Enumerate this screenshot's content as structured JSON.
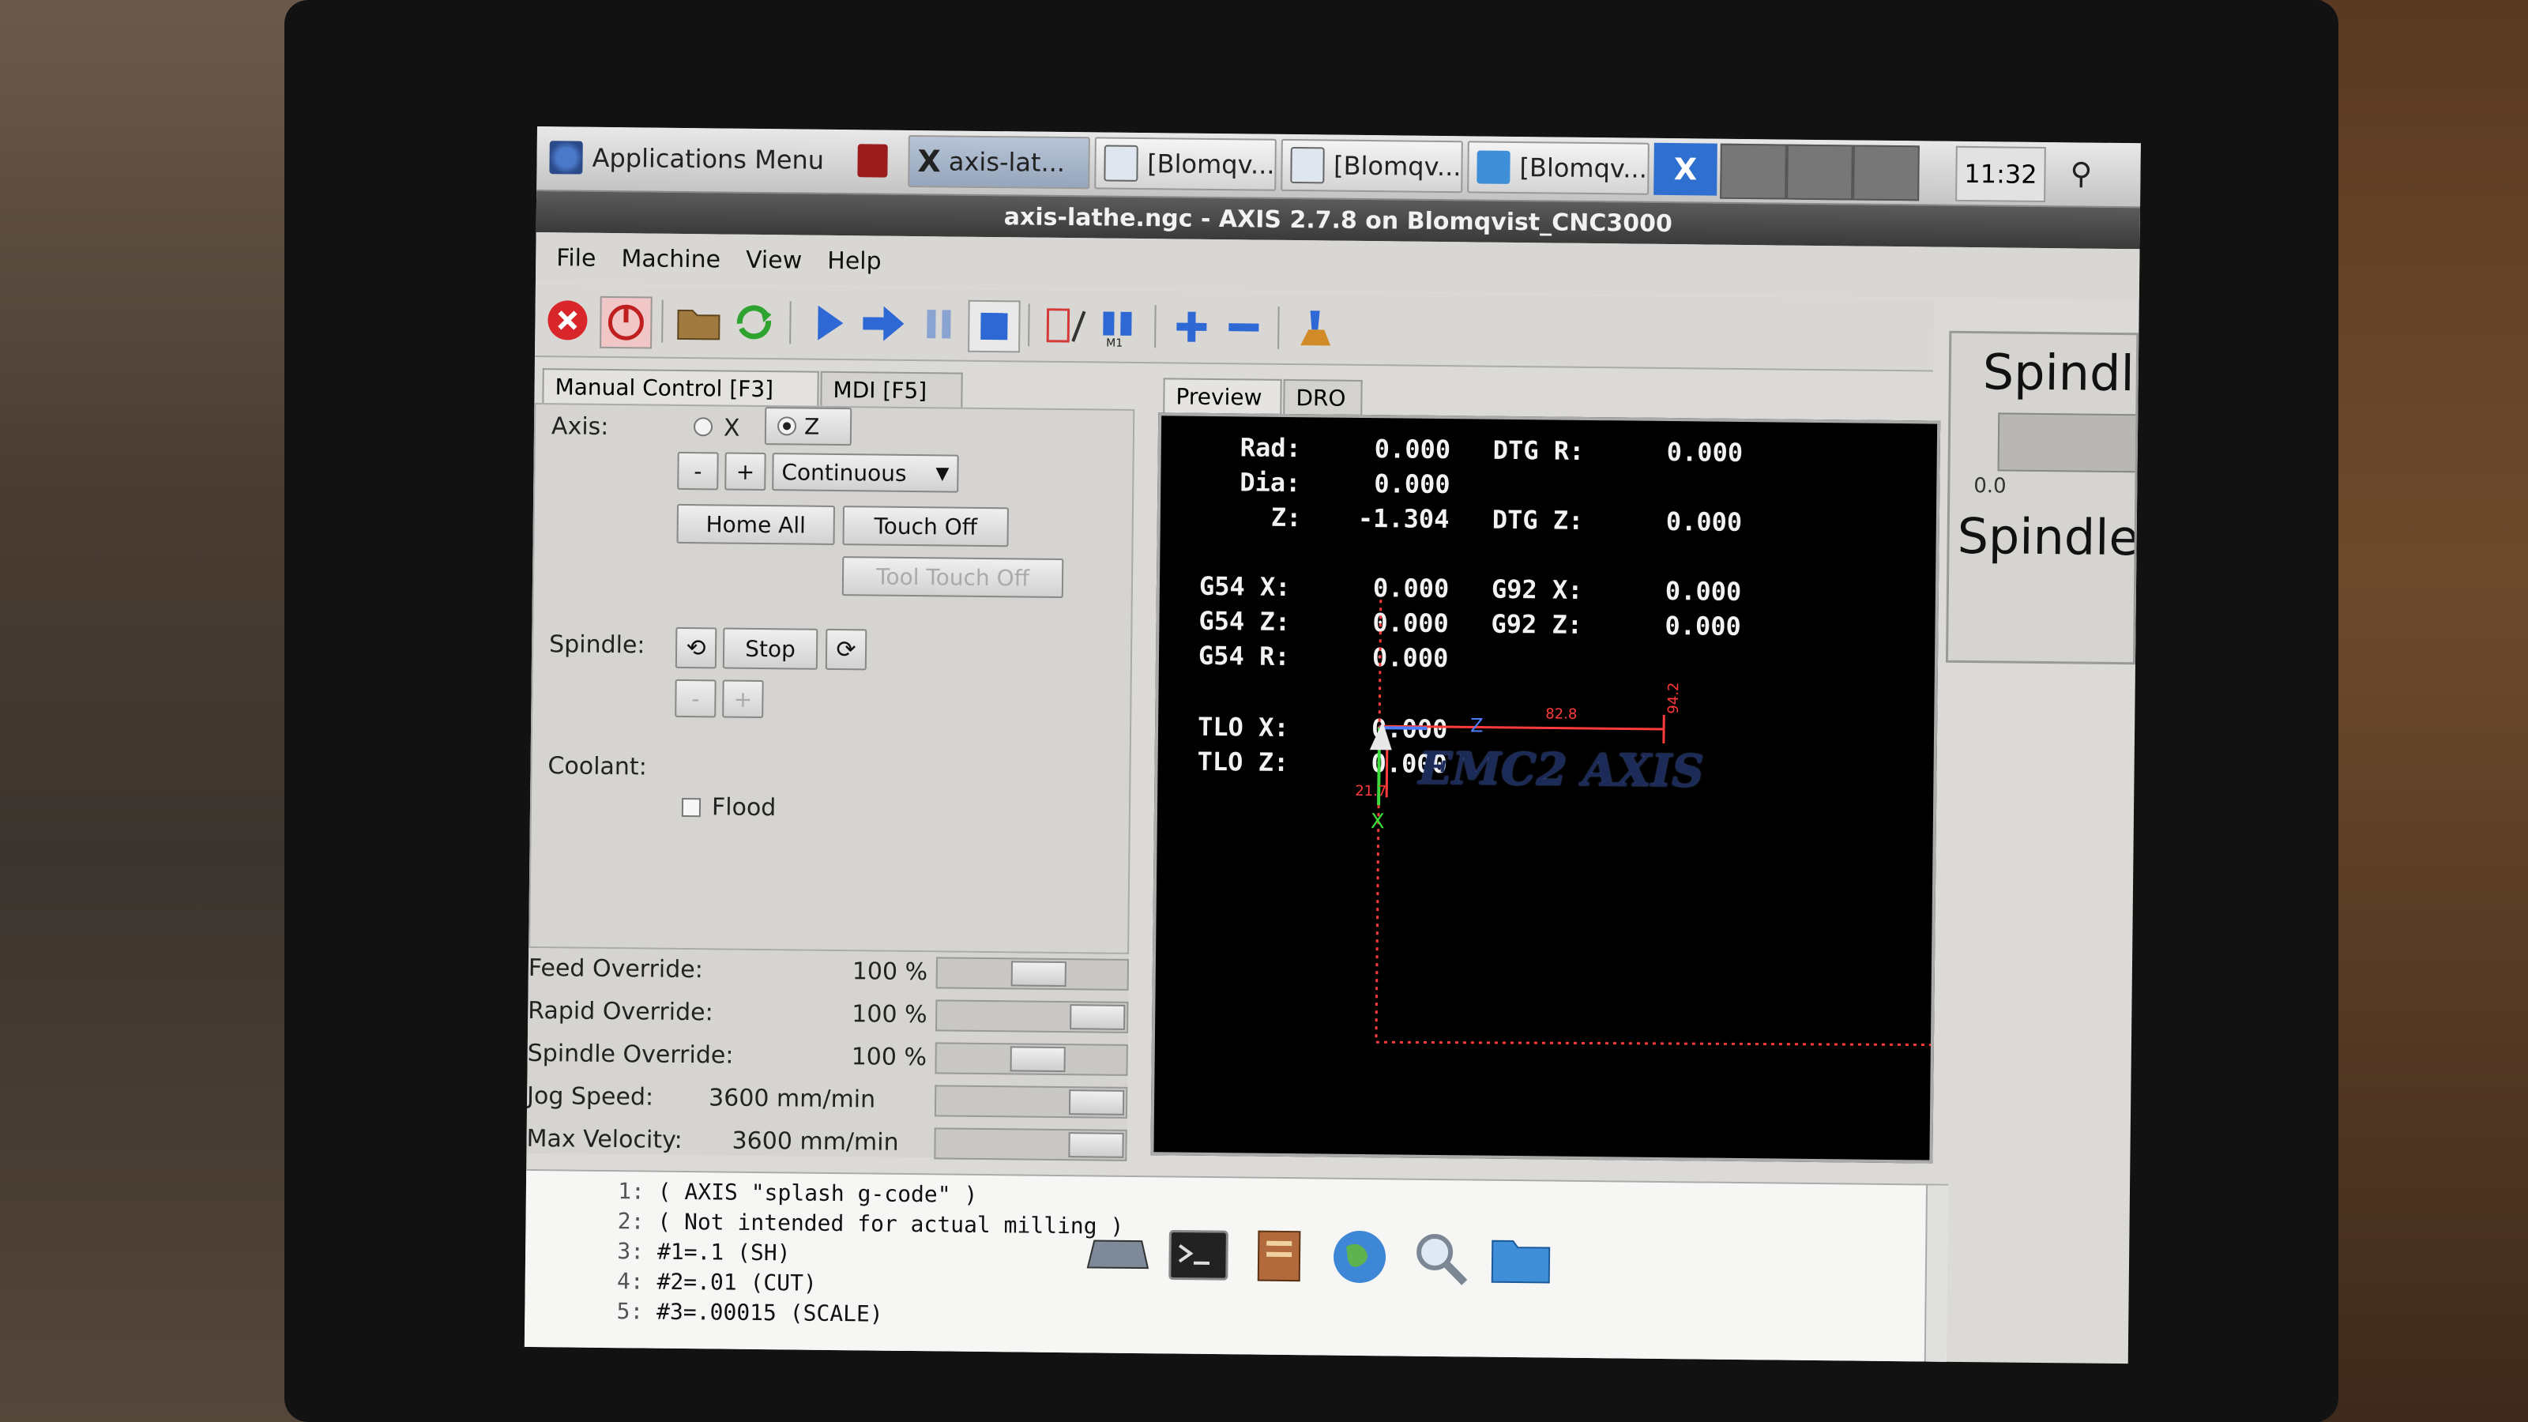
{
  "taskbar": {
    "apps_menu": "Applications Menu",
    "windows": [
      "axis-lat...",
      "[Blomqv...",
      "[Blomqv...",
      "[Blomqv..."
    ],
    "clock": "11:32"
  },
  "window_title": "axis-lathe.ngc - AXIS 2.7.8 on Blomqvist_CNC3000",
  "menu": [
    "File",
    "Machine",
    "View",
    "Help"
  ],
  "toolbar_icons": [
    "estop-icon",
    "power-icon",
    "open-icon",
    "reload-icon",
    "run-icon",
    "step-icon",
    "pause-icon",
    "stop-icon",
    "block-delete-icon",
    "optional-stop-icon",
    "zoom-in-icon",
    "zoom-out-icon",
    "clear-plot-icon"
  ],
  "left_tabs": [
    "Manual Control [F3]",
    "MDI [F5]"
  ],
  "manual": {
    "axis_label": "Axis:",
    "axis_x": "X",
    "axis_z": "Z",
    "jog_minus": "-",
    "jog_plus": "+",
    "jog_mode": "Continuous",
    "home_all": "Home All",
    "touch_off": "Touch Off",
    "tool_touch_off": "Tool Touch Off",
    "spindle_label": "Spindle:",
    "spindle_stop": "Stop",
    "spindle_minus": "-",
    "spindle_plus": "+",
    "coolant_label": "Coolant:",
    "flood": "Flood"
  },
  "overrides": [
    {
      "label": "Feed Override:",
      "value": "100 %",
      "level": 0.55
    },
    {
      "label": "Rapid Override:",
      "value": "100 %",
      "level": 1.0
    },
    {
      "label": "Spindle Override:",
      "value": "100 %",
      "level": 0.55
    },
    {
      "label": "Jog Speed:",
      "value": "3600 mm/min",
      "level": 1.0
    },
    {
      "label": "Max Velocity:",
      "value": "3600 mm/min",
      "level": 1.0
    }
  ],
  "preview_tabs": [
    "Preview",
    "DRO"
  ],
  "dro": {
    "rad_label": "Rad:",
    "rad": "0.000",
    "dtg_r_label": "DTG R:",
    "dtg_r": "0.000",
    "dia_label": "Dia:",
    "dia": "0.000",
    "z_label": "Z:",
    "z": "-1.304",
    "dtg_z_label": "DTG Z:",
    "dtg_z": "0.000",
    "g54x_label": "G54 X:",
    "g54x": "0.000",
    "g92x_label": "G92 X:",
    "g92x": "0.000",
    "g54z_label": "G54 Z:",
    "g54z": "0.000",
    "g92z_label": "G92 Z:",
    "g92z": "0.000",
    "g54r_label": "G54 R:",
    "g54r": "0.000",
    "tlox_label": "TLO X:",
    "tlox": "0.000",
    "tloz_label": "TLO Z:",
    "tloz": "0.000"
  },
  "plot": {
    "splash_text": "EMC2 AXIS",
    "dim_top": "82.8",
    "dim_right": "94.2",
    "dim_left_small": "21.7",
    "axis_x_label": "X",
    "axis_z_label": "Z",
    "colors": {
      "limits": "#ff3b3b",
      "axis_x": "#3bdc3b",
      "axis_z": "#4a7dff",
      "text": "#2b3f7a"
    }
  },
  "side": {
    "spindle_title": "Spindle",
    "spindle_value": "0.0",
    "spindle_title2": "Spindle"
  },
  "gcode": [
    {
      "n": "1:",
      "code": "( AXIS \"splash g-code\" )"
    },
    {
      "n": "2:",
      "code": "( Not intended for actual milling )"
    },
    {
      "n": "3:",
      "code": "#1=.1 (SH)"
    },
    {
      "n": "4:",
      "code": "#2=.01 (CUT)"
    },
    {
      "n": "5:",
      "code": "#3=.00015 (SCALE)"
    }
  ],
  "dock_icons": [
    "drive-icon",
    "terminal-icon",
    "file-manager-icon",
    "browser-icon",
    "search-icon",
    "folder-icon"
  ]
}
